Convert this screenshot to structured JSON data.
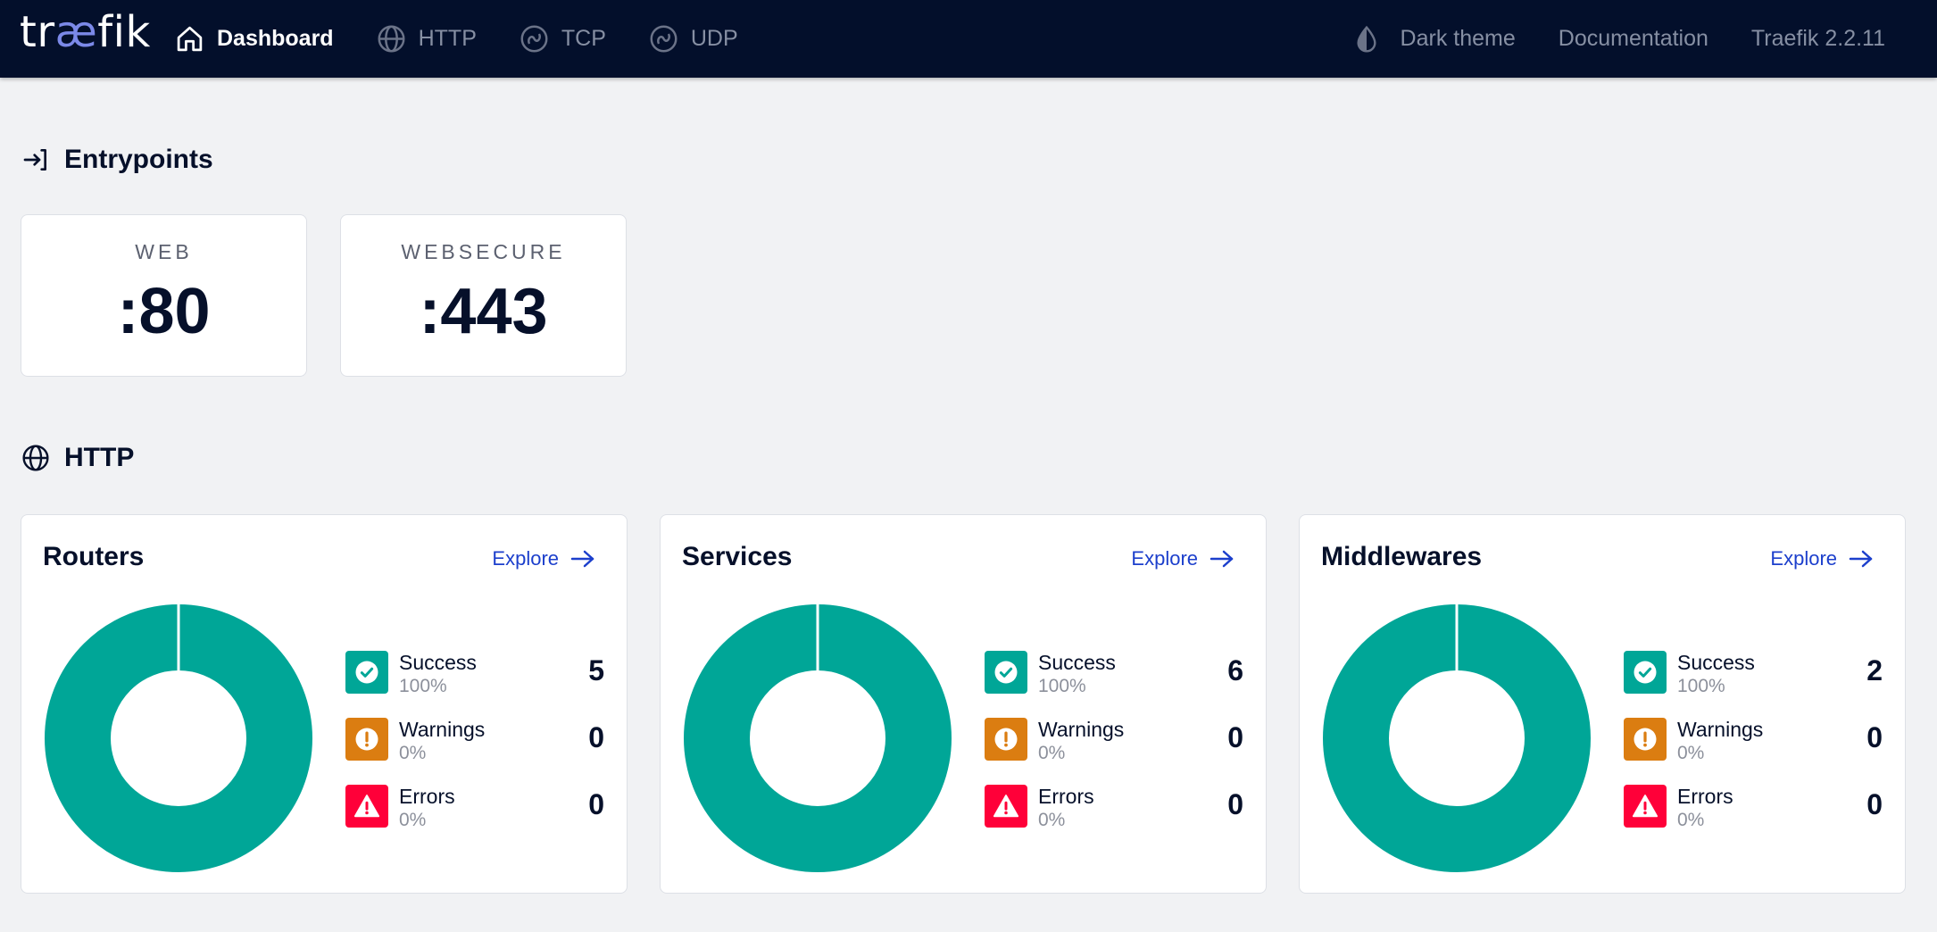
{
  "header": {
    "logo_prefix": "tr",
    "logo_ae": "æ",
    "logo_suffix": "fik",
    "nav": [
      {
        "label": "Dashboard",
        "icon": "home-icon",
        "active": true
      },
      {
        "label": "HTTP",
        "icon": "globe-icon",
        "active": false
      },
      {
        "label": "TCP",
        "icon": "tcp-icon",
        "active": false
      },
      {
        "label": "UDP",
        "icon": "udp-icon",
        "active": false
      }
    ],
    "theme_label": "Dark theme",
    "docs_label": "Documentation",
    "version_label": "Traefik 2.2.11"
  },
  "entrypoints": {
    "title": "Entrypoints",
    "items": [
      {
        "name": "WEB",
        "port": ":80"
      },
      {
        "name": "WEBSECURE",
        "port": ":443"
      }
    ]
  },
  "http": {
    "title": "HTTP",
    "explore_label": "Explore",
    "cards": [
      {
        "title": "Routers",
        "success": {
          "label": "Success",
          "pct": "100%",
          "count": "5"
        },
        "warnings": {
          "label": "Warnings",
          "pct": "0%",
          "count": "0"
        },
        "errors": {
          "label": "Errors",
          "pct": "0%",
          "count": "0"
        }
      },
      {
        "title": "Services",
        "success": {
          "label": "Success",
          "pct": "100%",
          "count": "6"
        },
        "warnings": {
          "label": "Warnings",
          "pct": "0%",
          "count": "0"
        },
        "errors": {
          "label": "Errors",
          "pct": "0%",
          "count": "0"
        }
      },
      {
        "title": "Middlewares",
        "success": {
          "label": "Success",
          "pct": "100%",
          "count": "2"
        },
        "warnings": {
          "label": "Warnings",
          "pct": "0%",
          "count": "0"
        },
        "errors": {
          "label": "Errors",
          "pct": "0%",
          "count": "0"
        }
      }
    ]
  },
  "colors": {
    "header_bg": "#030f2b",
    "success": "#00a697",
    "warning": "#db7d11",
    "error": "#ff0039",
    "link": "#1c3fcc"
  }
}
